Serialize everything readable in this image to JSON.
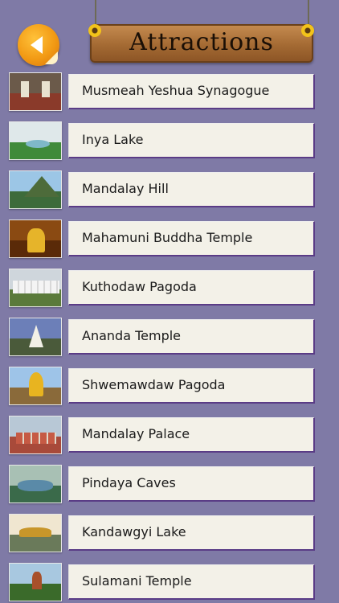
{
  "header": {
    "title": "Attractions",
    "back_icon": "back-arrow-icon"
  },
  "colors": {
    "background": "#7f7aa6",
    "panel": "#f3f1e8",
    "panel_border": "#5a3c86",
    "sign_wood": "#a46a33"
  },
  "attractions": [
    {
      "label": "Musmeah Yeshua Synagogue"
    },
    {
      "label": "Inya Lake"
    },
    {
      "label": "Mandalay Hill"
    },
    {
      "label": "Mahamuni Buddha Temple"
    },
    {
      "label": "Kuthodaw Pagoda"
    },
    {
      "label": "Ananda Temple"
    },
    {
      "label": "Shwemawdaw Pagoda"
    },
    {
      "label": "Mandalay Palace"
    },
    {
      "label": "Pindaya Caves"
    },
    {
      "label": "Kandawgyi Lake"
    },
    {
      "label": "Sulamani Temple"
    }
  ]
}
